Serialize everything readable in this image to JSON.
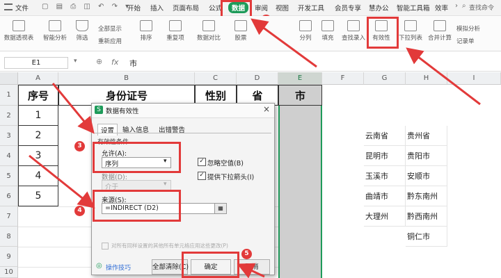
{
  "menubar": {
    "file": "文件",
    "items": [
      "开始",
      "插入",
      "页面布局",
      "公式",
      "数据",
      "审阅",
      "视图",
      "开发工具",
      "会员专享",
      "慧办公",
      "智能工具箱",
      "效率"
    ],
    "search": "查找命令"
  },
  "toolbar": {
    "buttons": [
      "数据透视表",
      "智能分析",
      "筛选",
      "全部显示",
      "重新应用",
      "排序",
      "重复项",
      "数据对比",
      "股票",
      "分列",
      "填充",
      "查找录入",
      "有效性",
      "下拉列表",
      "合并计算",
      "模拟分析",
      "记录单"
    ]
  },
  "formula_bar": {
    "cell_ref": "E1",
    "fx": "fx",
    "content": "市"
  },
  "sheet": {
    "columns": [
      "A",
      "B",
      "C",
      "D",
      "E",
      "F",
      "G",
      "H",
      "I"
    ],
    "rows": [
      "1",
      "2",
      "3",
      "4",
      "5",
      "6",
      "7",
      "8",
      "9",
      "10"
    ],
    "header_row": [
      "序号",
      "身份证号",
      "性别",
      "省",
      "市"
    ],
    "seq": [
      "1",
      "2",
      "3",
      "4",
      "5"
    ],
    "col_g": [
      "云南省",
      "昆明市",
      "玉溪市",
      "曲靖市",
      "大理州"
    ],
    "col_h": [
      "贵州省",
      "贵阳市",
      "安顺市",
      "黔东南州",
      "黔西南州",
      "铜仁市"
    ]
  },
  "dialog": {
    "title": "数据有效性",
    "tabs": [
      "设置",
      "输入信息",
      "出错警告"
    ],
    "section": "有效性条件",
    "allow_label": "允许(A):",
    "allow_value": "序列",
    "data_label": "数据(D):",
    "data_value": "介于",
    "ignore_blank": "忽略空值(B)",
    "dropdown_arrow": "提供下拉箭头(I)",
    "source_label": "来源(S):",
    "source_value": "=INDIRECT (D2)",
    "apply_all": "对所有同样设置的其他所有单元格应用这些更改(P)",
    "tips": "操作技巧",
    "clear_all": "全部清除(C)",
    "ok": "确定",
    "cancel": "取消"
  },
  "steps": [
    "1",
    "2",
    "3",
    "4",
    "5"
  ],
  "colors": {
    "accent": "#e23a3a",
    "highlight_col": "#cfcfcf",
    "selected_border": "#1e9b5a"
  }
}
